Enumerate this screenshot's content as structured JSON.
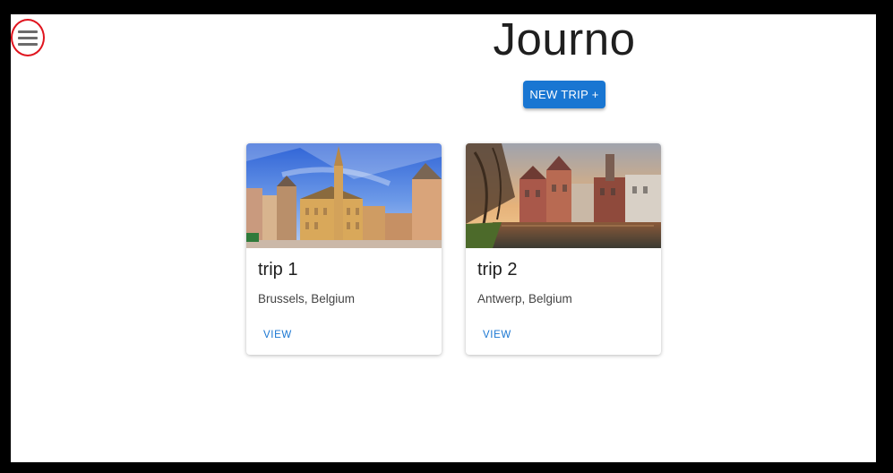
{
  "app": {
    "title": "Journo",
    "new_trip_label": "NEW TRIP +",
    "menu_icon": "hamburger-menu-icon"
  },
  "trips": [
    {
      "title": "trip 1",
      "location": "Brussels, Belgium",
      "action_label": "VIEW"
    },
    {
      "title": "trip 2",
      "location": "Antwerp, Belgium",
      "action_label": "VIEW"
    }
  ],
  "colors": {
    "primary": "#1976d2",
    "highlight": "#e0141e"
  }
}
